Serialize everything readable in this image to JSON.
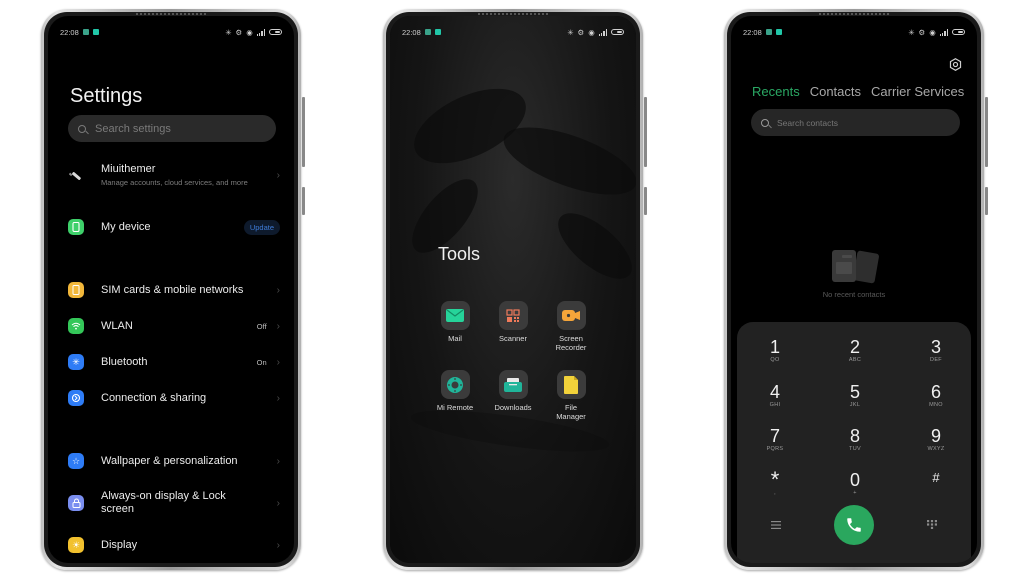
{
  "status_bar": {
    "time": "22:08"
  },
  "settings_screen": {
    "title": "Settings",
    "search_placeholder": "Search settings",
    "items": [
      {
        "label": "Miuithemer",
        "subtitle": "Manage accounts, cloud services, and more",
        "icon": "account-brush-icon",
        "color": "#d9d9d9"
      },
      {
        "label": "My device",
        "badge": "Update",
        "icon": "phone-device-icon",
        "color": "#3ed06a"
      },
      {
        "label": "SIM cards & mobile networks",
        "icon": "sim-card-icon",
        "color": "#f2b73a"
      },
      {
        "label": "WLAN",
        "value": "Off",
        "icon": "wifi-icon",
        "color": "#34c759"
      },
      {
        "label": "Bluetooth",
        "value": "On",
        "icon": "bluetooth-icon",
        "color": "#2e7cf6"
      },
      {
        "label": "Connection & sharing",
        "icon": "connection-icon",
        "color": "#2e7cf6"
      },
      {
        "label": "Wallpaper & personalization",
        "icon": "star-icon",
        "color": "#2e7cf6"
      },
      {
        "label": "Always-on display & Lock screen",
        "icon": "lock-icon",
        "color": "#7a8ef0"
      },
      {
        "label": "Display",
        "icon": "sun-icon",
        "color": "#f2c12e"
      }
    ]
  },
  "tools_screen": {
    "folder_title": "Tools",
    "apps": [
      {
        "label": "Mail",
        "icon": "mail-icon",
        "color": "#26d49a"
      },
      {
        "label": "Scanner",
        "icon": "scanner-icon",
        "color": "#f07a5a"
      },
      {
        "label": "Screen Recorder",
        "icon": "screen-recorder-icon",
        "color": "#f5a53a"
      },
      {
        "label": "Mi Remote",
        "icon": "mi-remote-icon",
        "color": "#20b59a"
      },
      {
        "label": "Downloads",
        "icon": "downloads-icon",
        "color": "#20b59a"
      },
      {
        "label": "File Manager",
        "icon": "file-manager-icon",
        "color": "#f2d23a"
      }
    ]
  },
  "dialer_screen": {
    "tabs": [
      {
        "label": "Recents",
        "active": true
      },
      {
        "label": "Contacts",
        "active": false
      },
      {
        "label": "Carrier Services",
        "active": false
      }
    ],
    "accent": "#2aa864",
    "search_placeholder": "Search contacts",
    "empty_text": "No recent contacts",
    "keys": [
      {
        "digit": "1",
        "letters": "QO"
      },
      {
        "digit": "2",
        "letters": "ABC"
      },
      {
        "digit": "3",
        "letters": "DEF"
      },
      {
        "digit": "4",
        "letters": "GHI"
      },
      {
        "digit": "5",
        "letters": "JKL"
      },
      {
        "digit": "6",
        "letters": "MNO"
      },
      {
        "digit": "7",
        "letters": "PQRS"
      },
      {
        "digit": "8",
        "letters": "TUV"
      },
      {
        "digit": "9",
        "letters": "WXYZ"
      },
      {
        "digit": "*",
        "letters": ","
      },
      {
        "digit": "0",
        "letters": "+"
      },
      {
        "digit": "#",
        "letters": ""
      }
    ],
    "call_color": "#2aa75e"
  }
}
